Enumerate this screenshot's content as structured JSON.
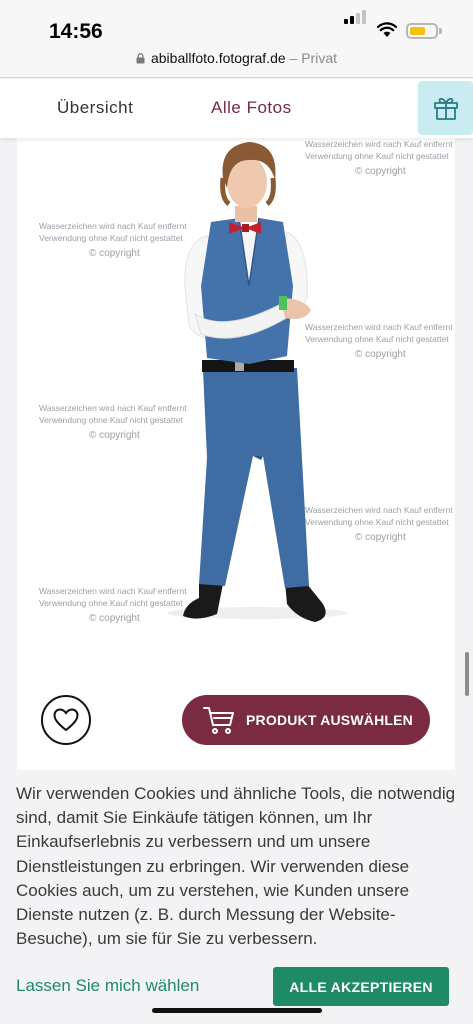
{
  "status": {
    "time": "14:56",
    "url": "abiballfoto.fotograf.de",
    "separator": "–",
    "privacy": "Privat"
  },
  "nav": {
    "tab_overview": "Übersicht",
    "tab_all_photos": "Alle Fotos",
    "gift_icon": "gift-icon"
  },
  "product": {
    "watermark_line1": "Wasserzeichen wird nach Kauf entfernt",
    "watermark_line2": "Verwendung ohne Kauf nicht gestattet",
    "watermark_copyright": "© copyright",
    "favorite_icon": "heart-icon",
    "cart_icon": "cart-icon",
    "select_button": "PRODUKT AUSWÄHLEN"
  },
  "cookie": {
    "text": "Wir verwenden Cookies und ähnliche Tools, die notwendig sind, damit Sie Einkäufe tätigen können, um Ihr Einkaufserlebnis zu verbessern und um unsere Dienstleistungen zu erbringen. Wir verwenden diese Cookies auch, um zu verstehen, wie Kunden unsere Dienste nutzen (z. B. durch Messung der Website-Besuche), um sie für Sie zu verbessern.",
    "choose": "Lassen Sie mich wählen",
    "accept": "ALLE AKZEPTIEREN"
  },
  "colors": {
    "brand": "#7a2a41",
    "accept": "#1e8a66",
    "gift_bg": "#c9ecf1",
    "battery": "#f4c20d"
  }
}
